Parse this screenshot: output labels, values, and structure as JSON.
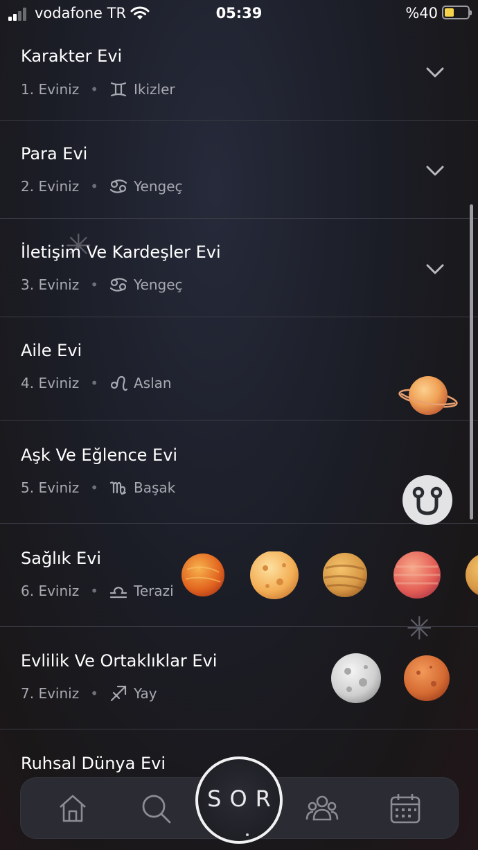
{
  "status_bar": {
    "carrier": "vodafone TR",
    "time": "05:39",
    "battery": "%40",
    "battery_level": 0.4
  },
  "houses": [
    {
      "title": "Karakter Evi",
      "number": "1. Eviniz",
      "sign": "Ikizler",
      "sign_icon": "gemini-icon",
      "trailing": "chevron-down-icon"
    },
    {
      "title": "Para Evi",
      "number": "2. Eviniz",
      "sign": "Yengeç",
      "sign_icon": "cancer-icon",
      "trailing": "chevron-down-icon"
    },
    {
      "title": "İletişim Ve Kardeşler Evi",
      "number": "3. Eviniz",
      "sign": "Yengeç",
      "sign_icon": "cancer-icon",
      "trailing": "chevron-down-icon"
    },
    {
      "title": "Aile Evi",
      "number": "4. Eviniz",
      "sign": "Aslan",
      "sign_icon": "leo-icon",
      "trailing": "saturn-planet-icon"
    },
    {
      "title": "Aşk Ve Eğlence Evi",
      "number": "5. Eviniz",
      "sign": "Başak",
      "sign_icon": "virgo-icon",
      "trailing": "uranus-glyph-icon"
    },
    {
      "title": "Sağlık Evi",
      "number": "6. Eviniz",
      "sign": "Terazi",
      "sign_icon": "libra-icon",
      "trailing": "planet-icons"
    },
    {
      "title": "Evlilik Ve Ortaklıklar Evi",
      "number": "7. Eviniz",
      "sign": "Yay",
      "sign_icon": "sagittarius-icon",
      "trailing": "planet-icons"
    },
    {
      "title": "Ruhsal Dünya Evi",
      "number": "",
      "sign": "",
      "sign_icon": "",
      "trailing": "chevron-down-icon"
    }
  ],
  "separator": "•",
  "colors": {
    "background": "#1b1d26",
    "title_text": "#ffffff",
    "meta_text": "#a8a9b1",
    "divider": "#3a3b44",
    "battery": "#f6d44a"
  },
  "tab_bar": {
    "items": [
      "home-icon",
      "search-icon",
      "sor-button",
      "community-icon",
      "calendar-icon"
    ],
    "center_label": "SOR"
  }
}
